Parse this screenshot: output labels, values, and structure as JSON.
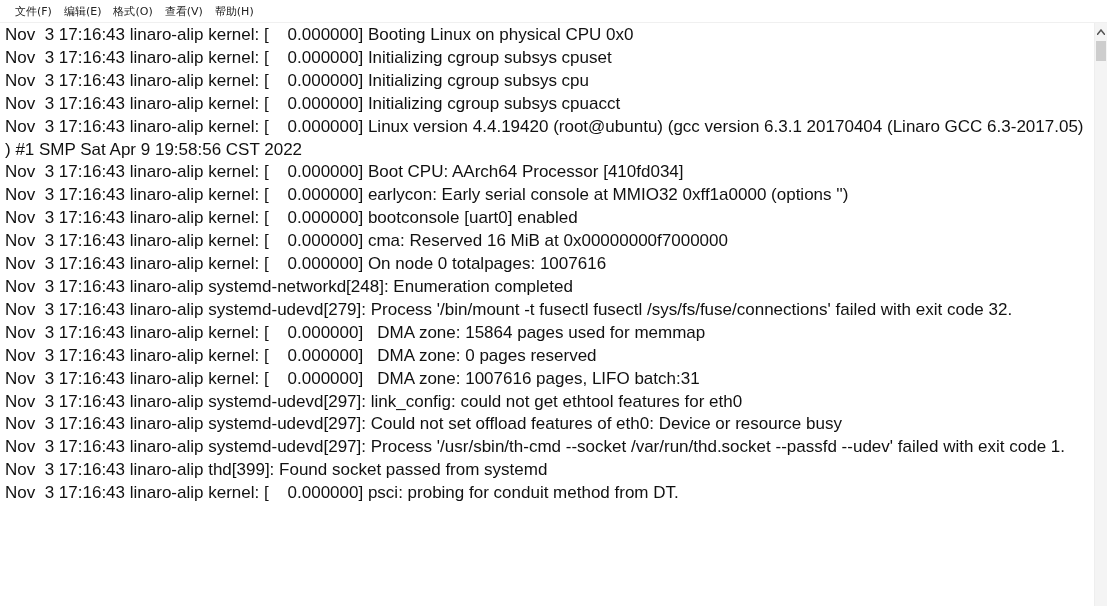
{
  "menu": [
    "文件(F)",
    "编辑(E)",
    "格式(O)",
    "查看(V)",
    "帮助(H)"
  ],
  "lines": [
    "Nov  3 17:16:43 linaro-alip kernel: [    0.000000] Booting Linux on physical CPU 0x0",
    "Nov  3 17:16:43 linaro-alip kernel: [    0.000000] Initializing cgroup subsys cpuset",
    "Nov  3 17:16:43 linaro-alip kernel: [    0.000000] Initializing cgroup subsys cpu",
    "Nov  3 17:16:43 linaro-alip kernel: [    0.000000] Initializing cgroup subsys cpuacct",
    "Nov  3 17:16:43 linaro-alip kernel: [    0.000000] Linux version 4.4.19420 (root@ubuntu) (gcc version 6.3.1 20170404 (Linaro GCC 6.3-2017.05) ) #1 SMP Sat Apr 9 19:58:56 CST 2022",
    "Nov  3 17:16:43 linaro-alip kernel: [    0.000000] Boot CPU: AArch64 Processor [410fd034]",
    "Nov  3 17:16:43 linaro-alip kernel: [    0.000000] earlycon: Early serial console at MMIO32 0xff1a0000 (options '')",
    "Nov  3 17:16:43 linaro-alip kernel: [    0.000000] bootconsole [uart0] enabled",
    "Nov  3 17:16:43 linaro-alip kernel: [    0.000000] cma: Reserved 16 MiB at 0x00000000f7000000",
    "Nov  3 17:16:43 linaro-alip kernel: [    0.000000] On node 0 totalpages: 1007616",
    "Nov  3 17:16:43 linaro-alip systemd-networkd[248]: Enumeration completed",
    "Nov  3 17:16:43 linaro-alip systemd-udevd[279]: Process '/bin/mount -t fusectl fusectl /sys/fs/fuse/connections' failed with exit code 32.",
    "Nov  3 17:16:43 linaro-alip kernel: [    0.000000]   DMA zone: 15864 pages used for memmap",
    "Nov  3 17:16:43 linaro-alip kernel: [    0.000000]   DMA zone: 0 pages reserved",
    "Nov  3 17:16:43 linaro-alip kernel: [    0.000000]   DMA zone: 1007616 pages, LIFO batch:31",
    "Nov  3 17:16:43 linaro-alip systemd-udevd[297]: link_config: could not get ethtool features for eth0",
    "Nov  3 17:16:43 linaro-alip systemd-udevd[297]: Could not set offload features of eth0: Device or resource busy",
    "Nov  3 17:16:43 linaro-alip systemd-udevd[297]: Process '/usr/sbin/th-cmd --socket /var/run/thd.socket --passfd --udev' failed with exit code 1.",
    "Nov  3 17:16:43 linaro-alip thd[399]: Found socket passed from systemd",
    "Nov  3 17:16:43 linaro-alip kernel: [    0.000000] psci: probing for conduit method from DT."
  ]
}
